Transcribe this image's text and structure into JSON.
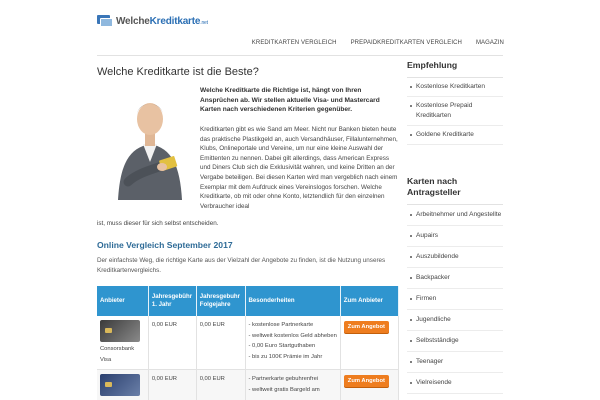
{
  "header": {
    "logo": {
      "part1": "Welche",
      "part2": "Kreditkarte",
      "tld": ".net"
    },
    "nav": [
      "KREDITKARTEN VERGLEICH",
      "PREPAIDKREDITKARTEN VERGLEICH",
      "MAGAZIN"
    ]
  },
  "main": {
    "title": "Welche Kreditkarte ist die Beste?",
    "intro_bold": "Welche Kreditkarte die Richtige ist, hängt von Ihren Ansprüchen ab. Wir stellen aktuelle Visa- und Mastercard Karten nach verschiedenen Kriterien gegenüber.",
    "intro_text": "Kreditkarten gibt es wie Sand am Meer. Nicht nur Banken bieten heute das praktische Plastikgeld an, auch Versandhäuser, Fillalunternehmen, Klubs, Onlineportale und Vereine, um nur eine kleine Auswahl der Emittenten zu nennen. Dabei gilt allerdings, dass American Express und Diners Club sich die Exklusivität wahren, und keine Dritten an der Vergabe beteiligen. Bei diesen Karten wird man vergeblich nach einem Exemplar mit dem Aufdruck eines Vereinslogos forschen. Welche Kreditkarte, ob mit oder ohne Konto, letztendlich für den einzelnen Verbraucher ideal",
    "intro_tail": "ist, muss dieser für sich selbst entscheiden.",
    "section_title": "Online Vergleich September 2017",
    "section_text": "Der einfachste Weg, die richtige Karte aus der Vielzahl der Angebote zu finden, ist die Nutzung unseres Kreditkartenvergleichs.",
    "table": {
      "headers": [
        "Anbieter",
        "Jahresgebühr 1. Jahr",
        "Jahresgebuhr Folgejahre",
        "Besonderheiten",
        "Zum Anbieter"
      ],
      "rows": [
        {
          "provider": "Consorsbank Visa",
          "fee_first": "0,00 EUR",
          "fee_following": "0,00 EUR",
          "features": [
            "- kostenlose Partnerkarte",
            "- weltweit kostenlos Geld abheben",
            "- 0,00 Euro Startguthaben",
            "- bis zu 100€ Prämie im Jahr"
          ],
          "button": "Zum Angebot"
        },
        {
          "provider": "",
          "fee_first": "0,00 EUR",
          "fee_following": "0,00 EUR",
          "features": [
            "- Partnerkarte gebuhrenfrei",
            "- weltweit gratis Bargeld am"
          ],
          "button": "Zum Angebot"
        }
      ]
    }
  },
  "sidebar": {
    "group1": {
      "title": "Empfehlung",
      "items": [
        "Kostenlose Kreditkarten",
        "Kostenlose Prepaid Kreditkarten",
        "Goldene Kreditkarte"
      ]
    },
    "group2": {
      "title": "Karten nach Antragsteller",
      "items": [
        "Arbeitnehmer und Angestellte",
        "Aupairs",
        "Auszubildende",
        "Backpacker",
        "Firmen",
        "Jugendliche",
        "Selbstständige",
        "Teenager",
        "Vielreisende"
      ]
    }
  },
  "colors": {
    "accent": "#2f95cf",
    "title_blue": "#2e6b97",
    "button": "#ee7d1f"
  }
}
